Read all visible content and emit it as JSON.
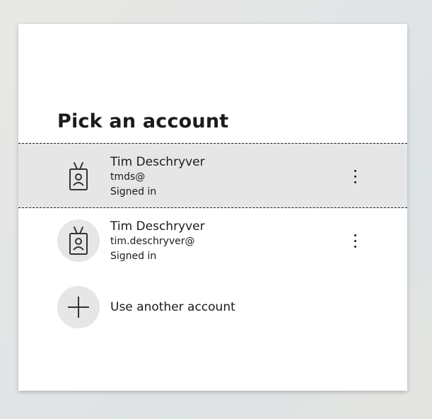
{
  "dialog": {
    "title": "Pick an account",
    "accounts": [
      {
        "name": "Tim Deschryver",
        "email": "tmds@",
        "status": "Signed in",
        "icon": "badge-icon",
        "selected": true
      },
      {
        "name": "Tim Deschryver",
        "email": "tim.deschryver@",
        "status": "Signed in",
        "icon": "badge-icon",
        "selected": false
      }
    ],
    "use_another": {
      "label": "Use another account",
      "icon": "plus-icon"
    }
  },
  "colors": {
    "selected_row_bg": "#e6e6e6",
    "avatar_bg": "#e6e6e6",
    "text": "#1b1b1b",
    "card_bg": "#ffffff"
  }
}
